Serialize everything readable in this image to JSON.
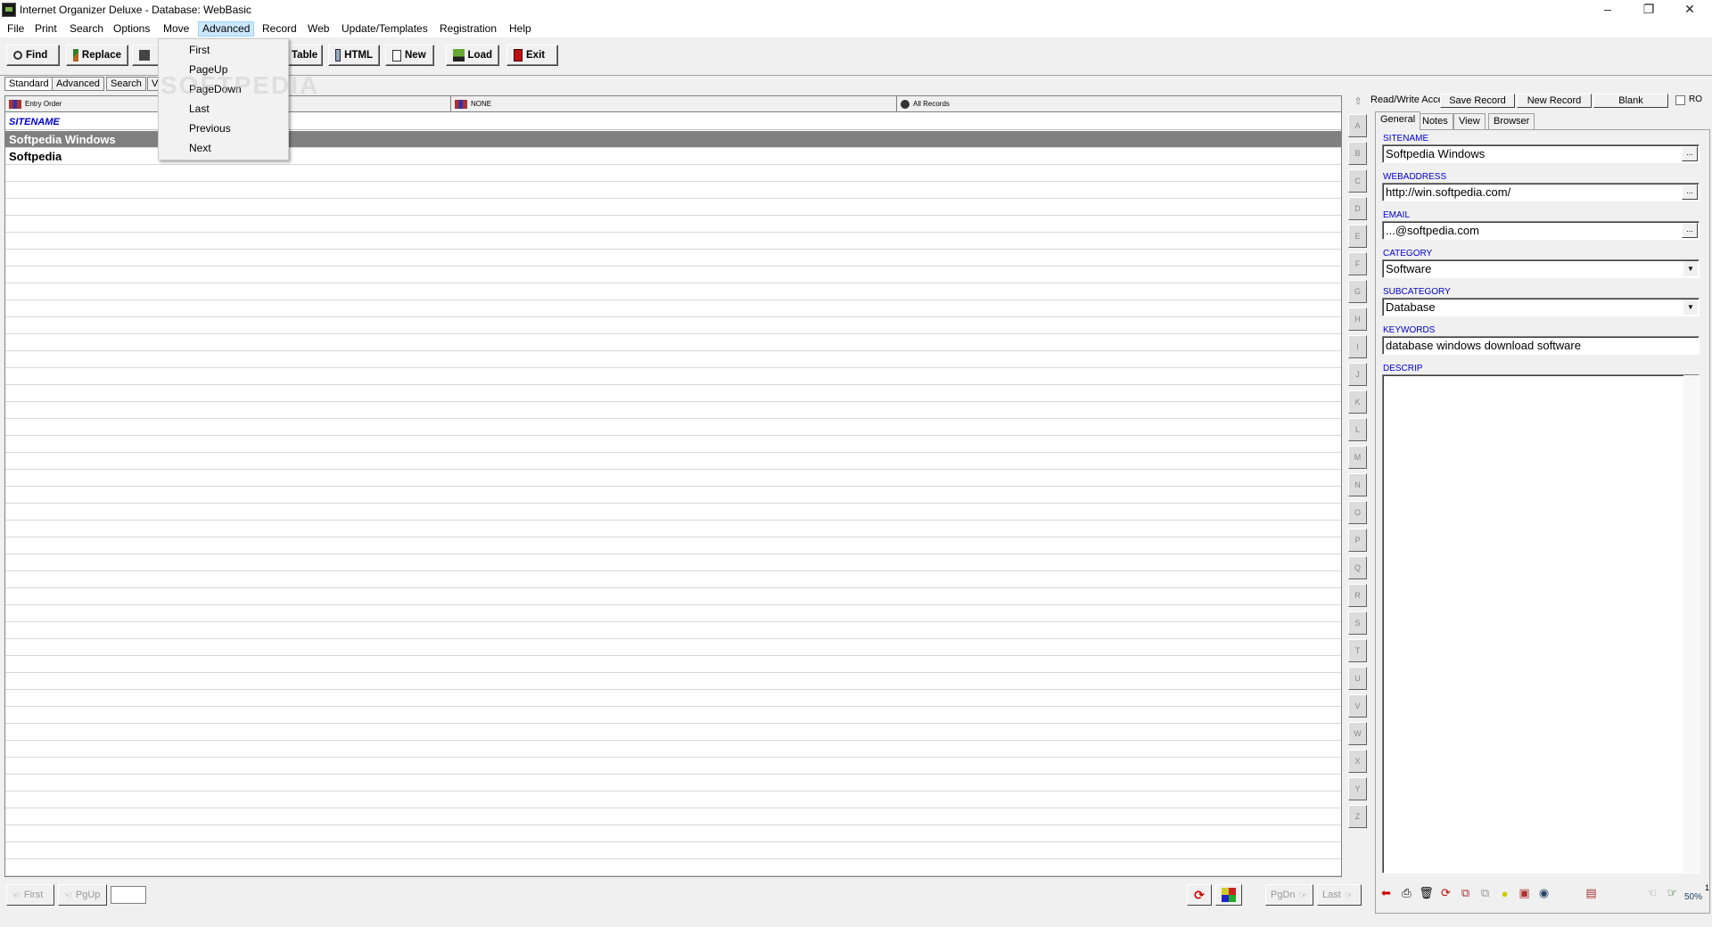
{
  "window": {
    "title": "Internet Organizer Deluxe - Database: WebBasic"
  },
  "menubar": [
    "File",
    "Print",
    "Search",
    "Options",
    "Move",
    "Advanced",
    "Record",
    "Web",
    "Update/Templates",
    "Registration",
    "Help"
  ],
  "active_menu": "Advanced",
  "dropdown": [
    "First",
    "PageUp",
    "PageDown",
    "Last",
    "Previous",
    "Next"
  ],
  "toolbar": {
    "find": "Find",
    "replace": "Replace",
    "table": "Table",
    "html": "HTML",
    "new": "New",
    "load": "Load",
    "exit": "Exit"
  },
  "view_tabs": [
    "Standard",
    "Advanced",
    "Search",
    "V"
  ],
  "list": {
    "columns": [
      "Entry Order",
      "NONE",
      "All Records"
    ],
    "field_header": "SITENAME",
    "rows": [
      "Softpedia Windows",
      "Softpedia"
    ]
  },
  "alphabet": [
    "A",
    "B",
    "C",
    "D",
    "E",
    "F",
    "G",
    "H",
    "I",
    "J",
    "K",
    "L",
    "M",
    "N",
    "O",
    "P",
    "Q",
    "R",
    "S",
    "T",
    "U",
    "V",
    "W",
    "X",
    "Y",
    "Z"
  ],
  "bottom": {
    "first": "First",
    "pgup": "PgUp",
    "pgdn": "PgDn",
    "last": "Last"
  },
  "right": {
    "access": "Read/Write Acce",
    "save_record": "Save Record",
    "new_record": "New Record",
    "blank": "Blank",
    "ro": "RO",
    "tabs": [
      "General",
      "Notes",
      "View",
      "Browser"
    ],
    "fields": {
      "sitename_label": "SITENAME",
      "sitename": "Softpedia Windows",
      "webaddress_label": "WEBADDRESS",
      "webaddress": "http://win.softpedia.com/",
      "email_label": "EMAIL",
      "email": "...@softpedia.com",
      "category_label": "CATEGORY",
      "category": "Software",
      "subcategory_label": "SUBCATEGORY",
      "subcategory": "Database",
      "keywords_label": "KEYWORDS",
      "keywords": "database windows download software",
      "descrip_label": "DESCRIP"
    },
    "zoom": "50%",
    "page_num": "1"
  },
  "watermark": "SOFTPEDIA",
  "colors": {
    "accent_blue": "#0000cc",
    "selected_row": "#808080",
    "menu_highlight": "#cce8ff"
  }
}
